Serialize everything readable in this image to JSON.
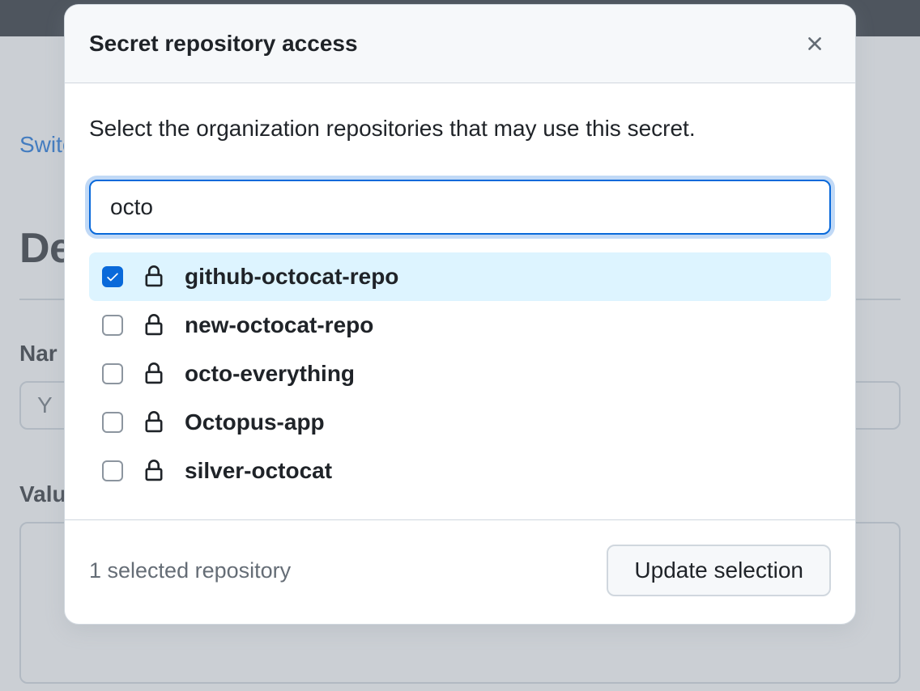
{
  "background": {
    "switch_link": "Switc",
    "heading": "De",
    "name_label": "Nar",
    "name_placeholder": "Y",
    "value_label": "Valu"
  },
  "modal": {
    "title": "Secret repository access",
    "description": "Select the organization repositories that may use this secret.",
    "search_value": "octo",
    "repos": [
      {
        "name": "github-octocat-repo",
        "checked": true
      },
      {
        "name": "new-octocat-repo",
        "checked": false
      },
      {
        "name": "octo-everything",
        "checked": false
      },
      {
        "name": "Octopus-app",
        "checked": false
      },
      {
        "name": "silver-octocat",
        "checked": false
      }
    ],
    "selected_text": "1 selected repository",
    "update_button": "Update selection"
  }
}
